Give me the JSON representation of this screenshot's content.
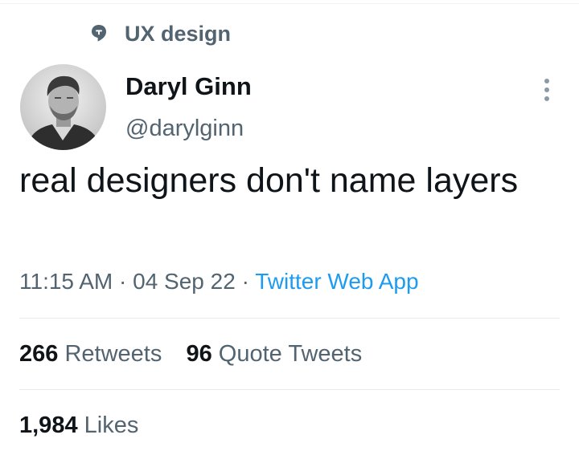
{
  "topic": {
    "icon": "topic-pin-icon",
    "label": "UX design"
  },
  "author": {
    "display_name": "Daryl Ginn",
    "handle": "@darylginn",
    "avatar": "avatar-photo"
  },
  "tweet": {
    "text": "real designers don't name layers",
    "time": "11:15 AM",
    "date": "04 Sep 22",
    "separator": "·",
    "source": "Twitter Web App"
  },
  "stats": {
    "retweets_count": "266",
    "retweets_label": "Retweets",
    "quotes_count": "96",
    "quotes_label": "Quote Tweets",
    "likes_count": "1,984",
    "likes_label": "Likes"
  },
  "colors": {
    "text_primary": "#0f1419",
    "text_secondary": "#536471",
    "link": "#1d9bf0",
    "divider": "#e7e9ea"
  },
  "icons": {
    "more": "more-vertical-icon"
  }
}
